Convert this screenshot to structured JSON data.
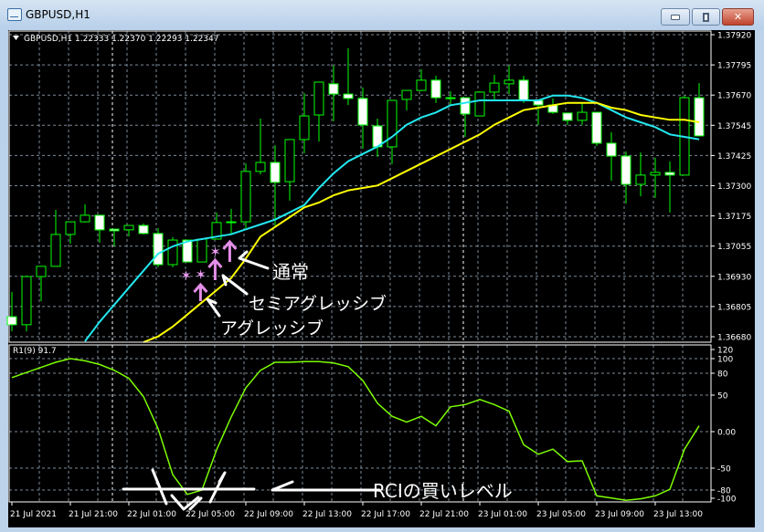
{
  "window": {
    "title": "GBPUSD,H1",
    "buttons": {
      "minimize": "minimize",
      "restore": "restore",
      "close": "close"
    }
  },
  "chart": {
    "header": "GBPUSD,H1  1.22333 1.22370 1.22293 1.22347",
    "colors": {
      "bull_fill": "#000000",
      "bear_fill": "#ffffff",
      "candle_outline": "#00ff00",
      "ma_fast": "#22e8f0",
      "ma_slow": "#ffff00",
      "rci": "#7cfc00",
      "grid": "#7d8a99",
      "background": "#000000"
    },
    "price_ticks": [
      "1.37920",
      "1.37795",
      "1.37670",
      "1.37545",
      "1.37425",
      "1.37300",
      "1.37175",
      "1.37055",
      "1.36930",
      "1.36805",
      "1.36680"
    ],
    "time_labels": [
      "21 Jul 2021",
      "21 Jul 21:00",
      "22 Jul 01:00",
      "22 Jul 05:00",
      "22 Jul 09:00",
      "22 Jul 13:00",
      "22 Jul 17:00",
      "22 Jul 21:00",
      "23 Jul 01:00",
      "23 Jul 05:00",
      "23 Jul 09:00",
      "23 Jul 13:00"
    ],
    "candles": [
      [
        1.36761,
        1.36863,
        1.36701,
        1.36728
      ],
      [
        1.36728,
        1.36926,
        1.36701,
        1.36926
      ],
      [
        1.36926,
        1.36968,
        1.36825,
        1.36968
      ],
      [
        1.36968,
        1.372,
        1.36968,
        1.37099
      ],
      [
        1.37099,
        1.37151,
        1.37061,
        1.37151
      ],
      [
        1.37151,
        1.37223,
        1.37148,
        1.37178
      ],
      [
        1.37178,
        1.37178,
        1.37065,
        1.37118
      ],
      [
        1.37121,
        1.37121,
        1.3705,
        1.37114
      ],
      [
        1.37118,
        1.37136,
        1.37091,
        1.37136
      ],
      [
        1.37136,
        1.37144,
        1.37099,
        1.37103
      ],
      [
        1.37103,
        1.37125,
        1.36964,
        1.36975
      ],
      [
        1.36975,
        1.37088,
        1.36964,
        1.37076
      ],
      [
        1.37076,
        1.37076,
        1.36986,
        1.36986
      ],
      [
        1.36986,
        1.3708,
        1.36986,
        1.3708
      ],
      [
        1.3708,
        1.37189,
        1.3708,
        1.37148
      ],
      [
        1.37148,
        1.37204,
        1.37099,
        1.37151
      ],
      [
        1.37151,
        1.37391,
        1.37125,
        1.37358
      ],
      [
        1.37358,
        1.37575,
        1.37346,
        1.37395
      ],
      [
        1.37395,
        1.37466,
        1.37133,
        1.37313
      ],
      [
        1.37316,
        1.37489,
        1.37238,
        1.37489
      ],
      [
        1.37489,
        1.3768,
        1.37433,
        1.37586
      ],
      [
        1.3759,
        1.37725,
        1.37481,
        1.37725
      ],
      [
        1.37718,
        1.37793,
        1.37564,
        1.37676
      ],
      [
        1.37676,
        1.37864,
        1.37631,
        1.37658
      ],
      [
        1.37658,
        1.37703,
        1.37451,
        1.37549
      ],
      [
        1.37545,
        1.37575,
        1.37418,
        1.37459
      ],
      [
        1.37459,
        1.3765,
        1.37388,
        1.3765
      ],
      [
        1.37654,
        1.37691,
        1.37609,
        1.37691
      ],
      [
        1.37691,
        1.37778,
        1.37688,
        1.37733
      ],
      [
        1.37733,
        1.37751,
        1.37639,
        1.37661
      ],
      [
        1.37661,
        1.37688,
        1.37631,
        1.37661
      ],
      [
        1.37661,
        1.37661,
        1.375,
        1.37594
      ],
      [
        1.37586,
        1.37688,
        1.37586,
        1.37684
      ],
      [
        1.37684,
        1.37755,
        1.3765,
        1.37721
      ],
      [
        1.37718,
        1.37793,
        1.37676,
        1.37733
      ],
      [
        1.37733,
        1.37751,
        1.37639,
        1.3765
      ],
      [
        1.3765,
        1.3765,
        1.37549,
        1.37631
      ],
      [
        1.37631,
        1.37658,
        1.37594,
        1.37601
      ],
      [
        1.37598,
        1.37598,
        1.37549,
        1.37568
      ],
      [
        1.37568,
        1.37639,
        1.37549,
        1.37601
      ],
      [
        1.37601,
        1.37601,
        1.37463,
        1.37474
      ],
      [
        1.37474,
        1.37519,
        1.3732,
        1.37421
      ],
      [
        1.37421,
        1.3744,
        1.37226,
        1.37305
      ],
      [
        1.37305,
        1.37436,
        1.37256,
        1.37343
      ],
      [
        1.37343,
        1.37414,
        1.37249,
        1.37354
      ],
      [
        1.37354,
        1.37399,
        1.37189,
        1.37343
      ],
      [
        1.37343,
        1.37669,
        1.37343,
        1.37661
      ],
      [
        1.37661,
        1.37721,
        1.37504,
        1.37504
      ]
    ],
    "ma_fast": {
      "start_index": 5,
      "values": [
        1.3666,
        1.3674,
        1.3681,
        1.3688,
        1.3695,
        1.3702,
        1.3705,
        1.3707,
        1.3708,
        1.3709,
        1.371,
        1.3712,
        1.3714,
        1.3716,
        1.3719,
        1.3722,
        1.3729,
        1.3735,
        1.374,
        1.3743,
        1.3746,
        1.375,
        1.3755,
        1.3758,
        1.376,
        1.3763,
        1.3764,
        1.3765,
        1.3765,
        1.3765,
        1.3765,
        1.3765,
        1.3767,
        1.3767,
        1.3766,
        1.3764,
        1.3761,
        1.3758,
        1.3756,
        1.3754,
        1.3751,
        1.375,
        1.3749
      ]
    },
    "ma_slow": {
      "start_index": 9,
      "values": [
        1.3665,
        1.3668,
        1.3672,
        1.3677,
        1.3682,
        1.3687,
        1.3692,
        1.37,
        1.3709,
        1.3713,
        1.3717,
        1.3721,
        1.3723,
        1.3726,
        1.3728,
        1.3729,
        1.373,
        1.3733,
        1.3736,
        1.3739,
        1.3742,
        1.3745,
        1.3748,
        1.3751,
        1.3755,
        1.3758,
        1.3761,
        1.3762,
        1.3763,
        1.3764,
        1.3764,
        1.3764,
        1.3762,
        1.3761,
        1.3759,
        1.3758,
        1.3757,
        1.3757,
        1.3756
      ]
    },
    "signals": {
      "stars": [
        11.9,
        12.9,
        13.9
      ],
      "arrows": [
        12.9,
        13.9,
        14.9
      ]
    }
  },
  "rci": {
    "label": "R1(9) 91.7",
    "ticks": [
      "120",
      "100",
      "80",
      "50",
      "0.00",
      "-50",
      "-80",
      "-100"
    ],
    "values": [
      74,
      81,
      88,
      95,
      100,
      97,
      92,
      84,
      73,
      48,
      4,
      -59,
      -86,
      -80,
      -25,
      20,
      60,
      84,
      95,
      95,
      96,
      96,
      94,
      89,
      70,
      39,
      21,
      13,
      21,
      8,
      34,
      37,
      44,
      37,
      28,
      -18,
      -31,
      -24,
      -41,
      -40,
      -88,
      -91,
      -94,
      -92,
      -88,
      -79,
      -24,
      8
    ],
    "buy_level": -80
  },
  "annotations": {
    "normal": "通常",
    "semi_aggressive": "セミアグレッシブ",
    "aggressive": "アグレッシブ",
    "rci_buy_level": "RCIの買いレベル"
  }
}
